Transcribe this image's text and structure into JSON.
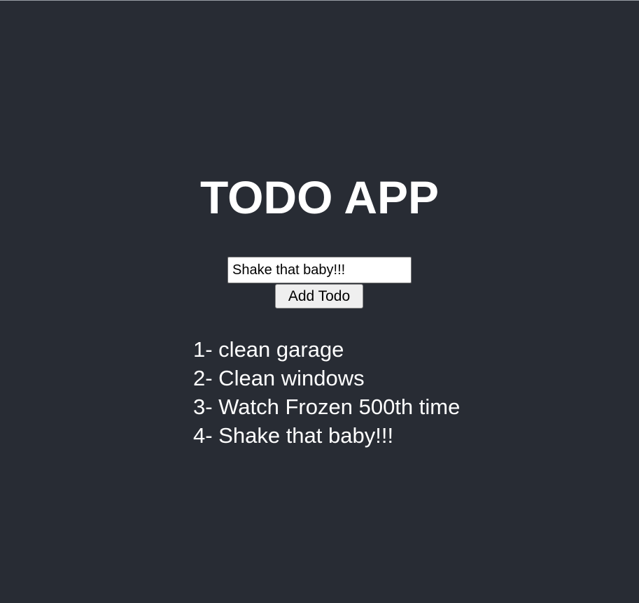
{
  "header": {
    "title": "TODO APP"
  },
  "form": {
    "input_value": "Shake that baby!!!",
    "add_button_label": "Add Todo"
  },
  "todos": [
    {
      "label": "1- clean garage"
    },
    {
      "label": "2- Clean windows"
    },
    {
      "label": "3- Watch Frozen 500th time"
    },
    {
      "label": "4- Shake that baby!!!"
    }
  ],
  "colors": {
    "background": "#282c34",
    "text": "#ffffff",
    "button_background": "#efefef"
  }
}
